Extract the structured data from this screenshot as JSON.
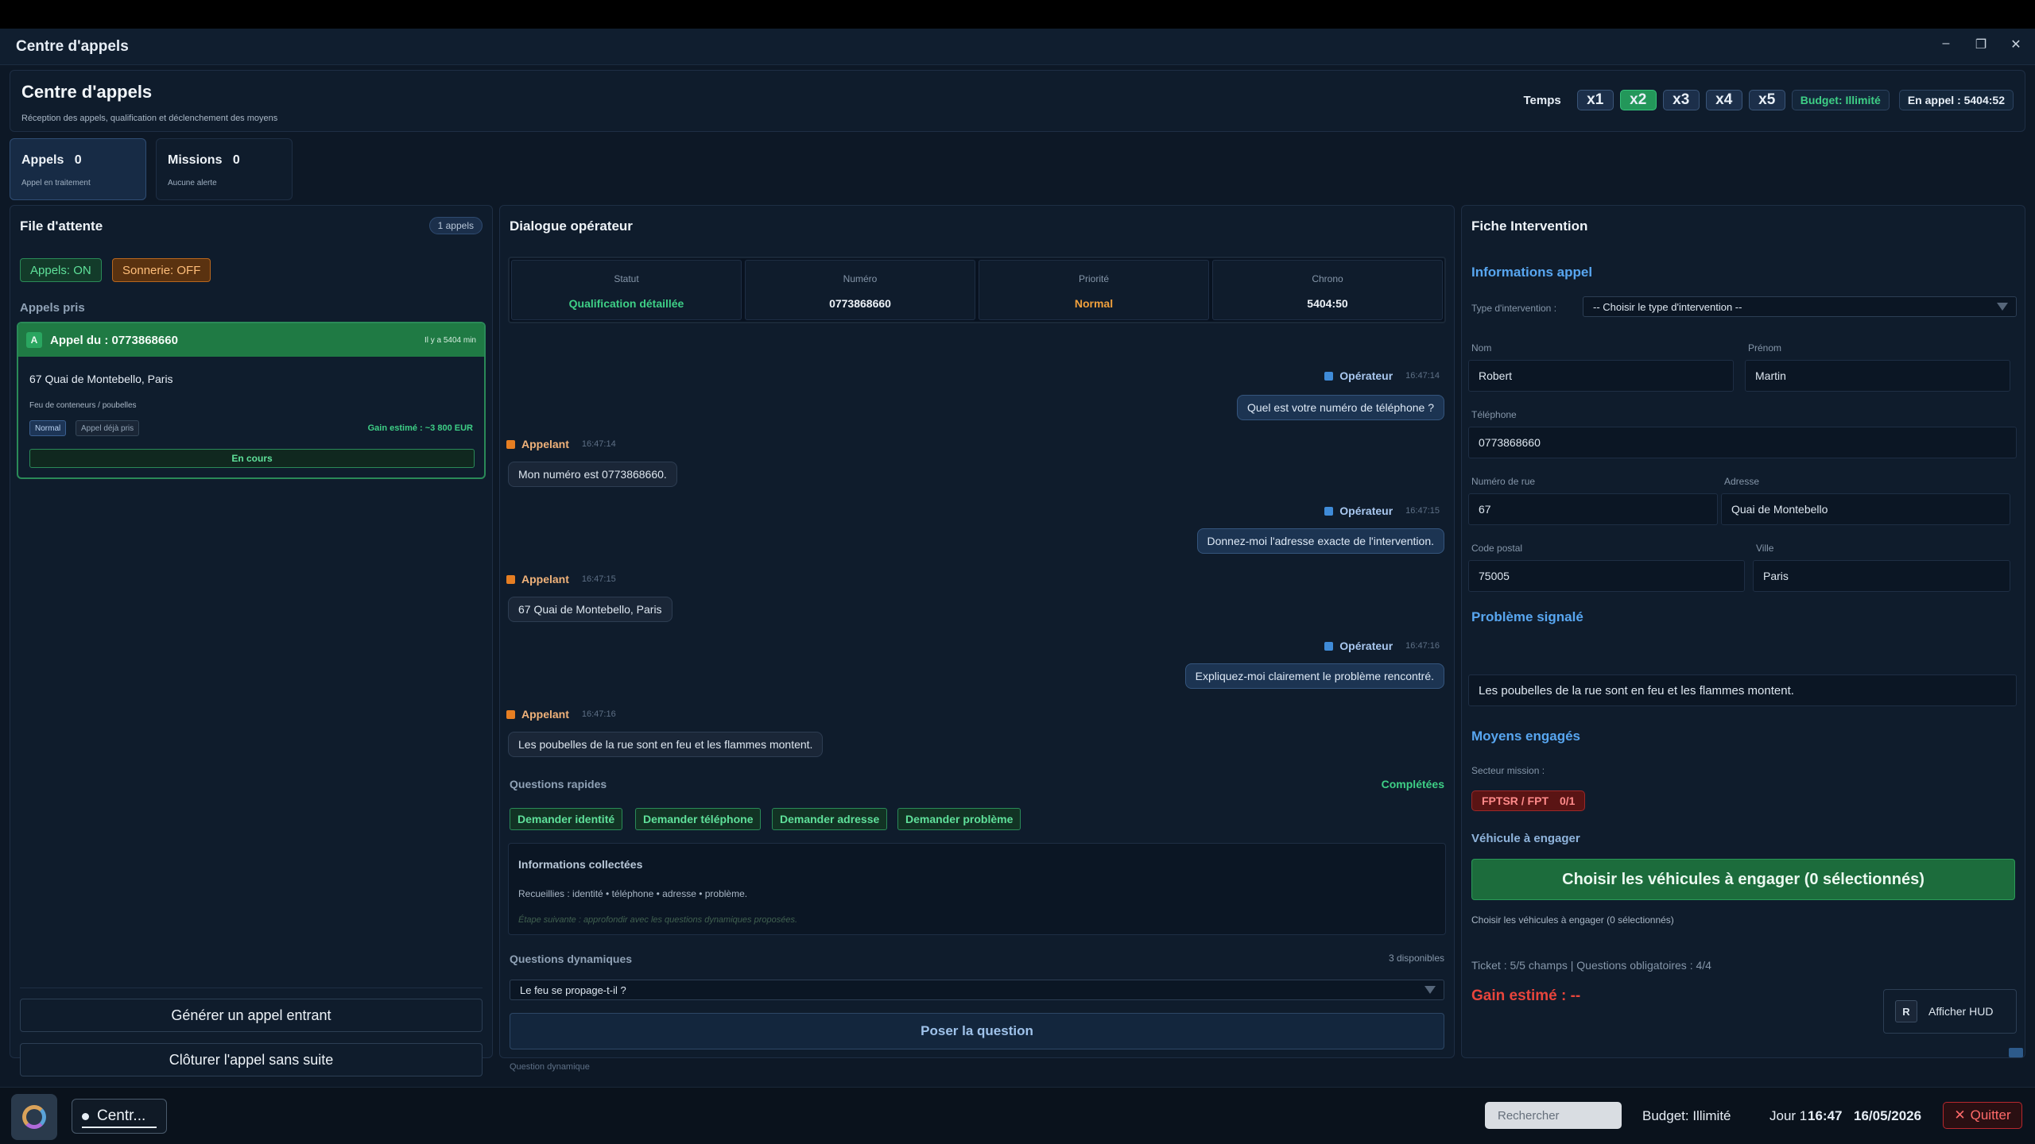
{
  "window": {
    "title": "Centre d'appels",
    "controls": {
      "minimize": "–",
      "maximize": "❐",
      "close": "✕"
    }
  },
  "header": {
    "title": "Centre d'appels",
    "subtitle": "Réception des appels, qualification et déclenchement des moyens",
    "time_label": "Temps",
    "speeds": [
      "x1",
      "x2",
      "x3",
      "x4",
      "x5"
    ],
    "active_speed": "x2",
    "budget": "Budget: Illimité",
    "in_call": "En appel : 5404:52"
  },
  "tabs": [
    {
      "name": "Appels",
      "count": "0",
      "sub": "Appel en traitement"
    },
    {
      "name": "Missions",
      "count": "0",
      "sub": "Aucune alerte"
    }
  ],
  "queue": {
    "title": "File d'attente",
    "badge": "1 appels",
    "toggle_calls": "Appels: ON",
    "toggle_ring": "Sonnerie: OFF",
    "section": "Appels pris",
    "call": {
      "avatar": "A",
      "title": "Appel du : 0773868660",
      "ago": "Il y a 5404 min",
      "address": "67 Quai de Montebello, Paris",
      "description": "Feu de conteneurs / poubelles",
      "tag_priority": "Normal",
      "tag_taken": "Appel déjà pris",
      "gain": "Gain estimé : ~3 800 EUR",
      "status": "En cours"
    },
    "btn_generate": "Générer un appel entrant",
    "btn_close": "Clôturer l'appel sans suite"
  },
  "dialog": {
    "title": "Dialogue opérateur",
    "stats": [
      {
        "label": "Statut",
        "value": "Qualification détaillée"
      },
      {
        "label": "Numéro",
        "value": "0773868660"
      },
      {
        "label": "Priorité",
        "value": "Normal"
      },
      {
        "label": "Chrono",
        "value": "5404:50"
      }
    ],
    "messages": [
      {
        "role": "operator",
        "who": "Opérateur",
        "time": "16:47:14",
        "text": "Quel est votre numéro de téléphone ?"
      },
      {
        "role": "caller",
        "who": "Appelant",
        "time": "16:47:14",
        "text": "Mon numéro est 0773868660."
      },
      {
        "role": "operator",
        "who": "Opérateur",
        "time": "16:47:15",
        "text": "Donnez-moi l'adresse exacte de l'intervention."
      },
      {
        "role": "caller",
        "who": "Appelant",
        "time": "16:47:15",
        "text": "67 Quai de Montebello, Paris"
      },
      {
        "role": "operator",
        "who": "Opérateur",
        "time": "16:47:16",
        "text": "Expliquez-moi clairement le problème rencontré."
      },
      {
        "role": "caller",
        "who": "Appelant",
        "time": "16:47:16",
        "text": "Les poubelles de la rue sont en feu et les flammes montent."
      }
    ],
    "quick_title": "Questions rapides",
    "quick_status": "Complétées",
    "quick": [
      "Demander identité",
      "Demander téléphone",
      "Demander adresse",
      "Demander problème"
    ],
    "info_title": "Informations collectées",
    "info_text": "Recueillies : identité • téléphone • adresse • problème.",
    "info_next": "Étape suivante : approfondir avec les questions dynamiques proposées.",
    "dyn_title": "Questions dynamiques",
    "dyn_count": "3 disponibles",
    "dyn_selected": "Le feu se propage-t-il ?",
    "ask_button": "Poser la question",
    "dyn_footer": "Question dynamique"
  },
  "form": {
    "title": "Fiche Intervention",
    "sec_info": "Informations appel",
    "type_label": "Type d'intervention :",
    "type_value": "-- Choisir le type d'intervention --",
    "nom_label": "Nom",
    "nom": "Robert",
    "prenom_label": "Prénom",
    "prenom": "Martin",
    "tel_label": "Téléphone",
    "tel": "0773868660",
    "num_label": "Numéro de rue",
    "num": "67",
    "adr_label": "Adresse",
    "adr": "Quai de Montebello",
    "cp_label": "Code postal",
    "cp": "75005",
    "ville_label": "Ville",
    "ville": "Paris",
    "sec_problem": "Problème signalé",
    "problem": "Les poubelles de la rue sont en feu et les flammes montent.",
    "sec_means": "Moyens engagés",
    "sector_label": "Secteur mission :",
    "sector_name": "FPTSR / FPT",
    "sector_count": "0/1",
    "vehicle_label": "Véhicule à engager",
    "vehicle_button": "Choisir les véhicules à engager (0 sélectionnés)",
    "vehicle_sub": "Choisir les véhicules à engager (0 sélectionnés)",
    "ticket": "Ticket : 5/5 champs  |  Questions obligatoires : 4/4",
    "gain": "Gain estimé : --",
    "hud_key": "R",
    "hud_label": "Afficher HUD"
  },
  "taskbar": {
    "task_label": "Centr...",
    "search_placeholder": "Rechercher",
    "budget": "Budget: Illimité",
    "day": "Jour 1",
    "time": "16:47",
    "date": "16/05/2026",
    "quit": "Quitter",
    "quit_icon": "✕"
  },
  "colors": {
    "accent_green": "#23975a",
    "accent_blue": "#58a6f0",
    "priority_orange": "#f0a03c",
    "alert_red": "#e8453c"
  }
}
